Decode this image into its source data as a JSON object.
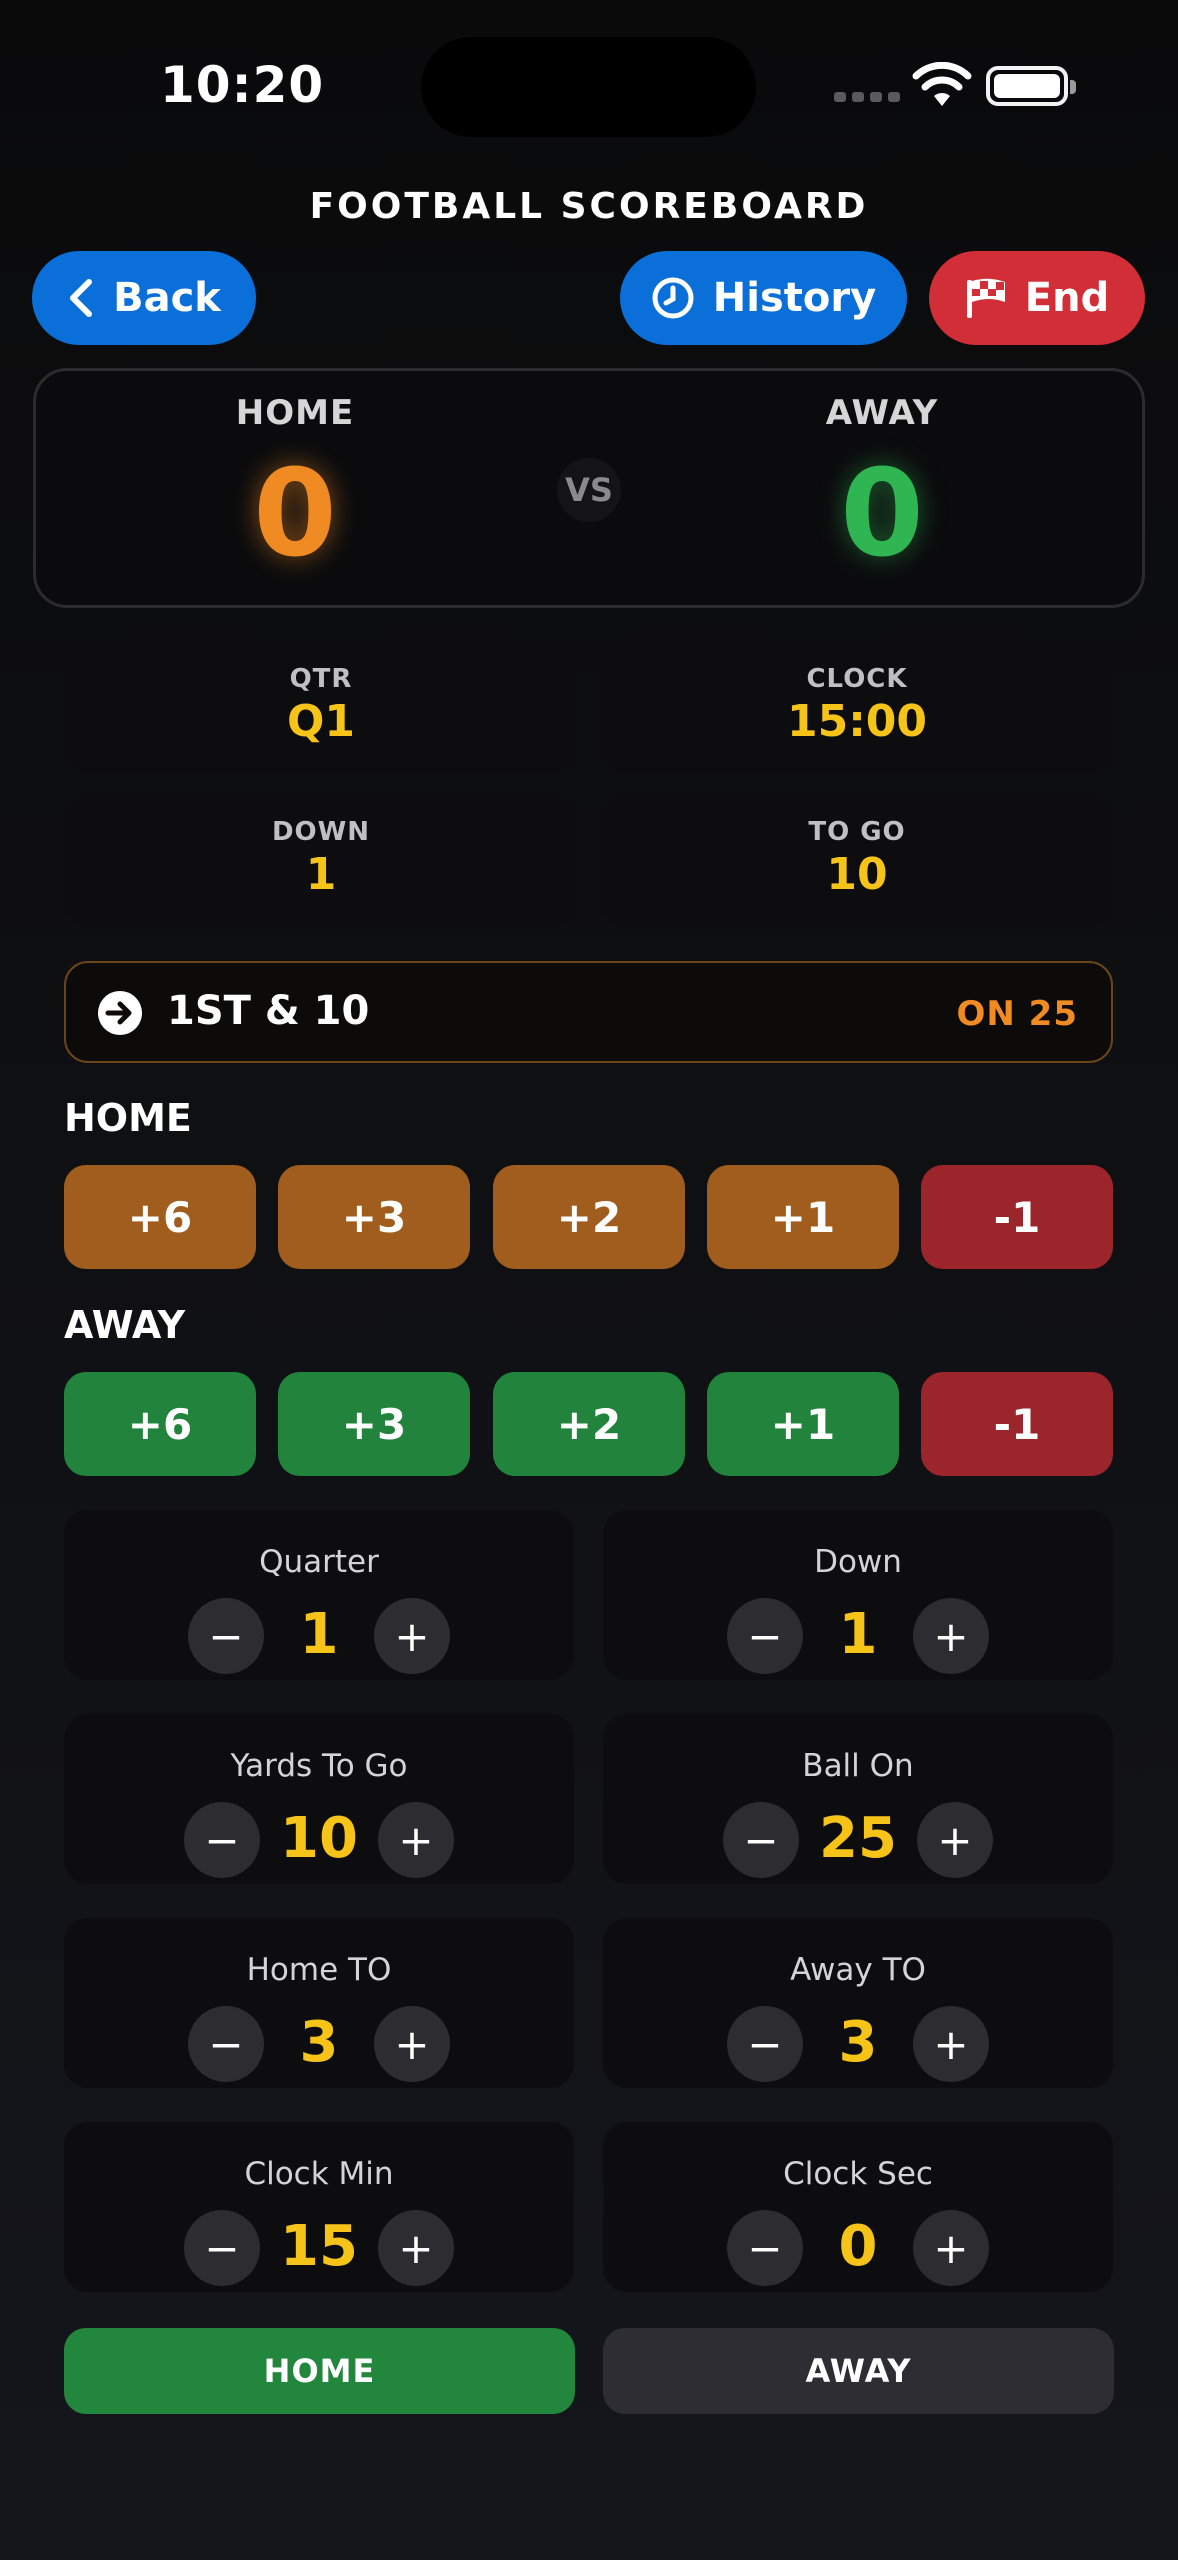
{
  "status_bar": {
    "time": "10:20"
  },
  "header": {
    "title": "FOOTBALL SCOREBOARD"
  },
  "nav": {
    "back_label": "Back",
    "history_label": "History",
    "end_label": "End"
  },
  "scoreboard": {
    "home_label": "HOME",
    "away_label": "AWAY",
    "home_score": "0",
    "away_score": "0",
    "vs": "VS"
  },
  "info": [
    {
      "label": "QTR",
      "value": "Q1"
    },
    {
      "label": "CLOCK",
      "value": "15:00"
    },
    {
      "label": "DOWN",
      "value": "1"
    },
    {
      "label": "TO GO",
      "value": "10"
    }
  ],
  "down_bar": {
    "text": "1ST & 10",
    "ball_on": "ON 25"
  },
  "home_section": {
    "title": "HOME",
    "buttons": [
      "+6",
      "+3",
      "+2",
      "+1",
      "-1"
    ]
  },
  "away_section": {
    "title": "AWAY",
    "buttons": [
      "+6",
      "+3",
      "+2",
      "+1",
      "-1"
    ]
  },
  "steppers": [
    {
      "label": "Quarter",
      "value": "1"
    },
    {
      "label": "Down",
      "value": "1"
    },
    {
      "label": "Yards To Go",
      "value": "10"
    },
    {
      "label": "Ball On",
      "value": "25"
    },
    {
      "label": "Home TO",
      "value": "3"
    },
    {
      "label": "Away TO",
      "value": "3"
    },
    {
      "label": "Clock Min",
      "value": "15"
    },
    {
      "label": "Clock Sec",
      "value": "0"
    }
  ],
  "stepper_symbols": {
    "minus": "−",
    "plus": "+"
  },
  "possession": {
    "home_label": "HOME",
    "away_label": "AWAY",
    "selected": "HOME"
  },
  "colors": {
    "accent_blue": "#0a6fd8",
    "end_red": "#d12e38",
    "home_orange": "#f08a22",
    "away_green": "#2fb652",
    "value_yellow": "#f6c318"
  }
}
